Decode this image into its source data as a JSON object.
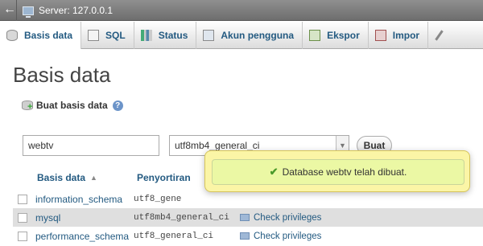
{
  "topbar": {
    "back_icon": "back-arrow-icon",
    "server_label": "Server: 127.0.0.1"
  },
  "tabs": [
    {
      "label": "Basis data",
      "icon": "database-icon",
      "active": true
    },
    {
      "label": "SQL",
      "icon": "sql-icon"
    },
    {
      "label": "Status",
      "icon": "status-icon"
    },
    {
      "label": "Akun pengguna",
      "icon": "user-accounts-icon"
    },
    {
      "label": "Ekspor",
      "icon": "export-icon"
    },
    {
      "label": "Impor",
      "icon": "import-icon"
    }
  ],
  "page": {
    "title": "Basis data",
    "create_label": "Buat basis data",
    "db_name_value": "webtv",
    "collation_value": "utf8mb4_general_ci",
    "create_button": "Buat"
  },
  "table": {
    "headers": {
      "database": "Basis data",
      "collation": "Penyortiran",
      "sort_icon": "sort-asc-icon"
    },
    "rows": [
      {
        "name": "information_schema",
        "collation": "utf8_gene",
        "privileges": ""
      },
      {
        "name": "mysql",
        "collation": "utf8mb4_general_ci",
        "privileges": "Check privileges"
      },
      {
        "name": "performance_schema",
        "collation": "utf8_general_ci",
        "privileges": "Check privileges"
      }
    ]
  },
  "notification": {
    "message": "Database webtv telah dibuat.",
    "icon": "success-check-icon"
  },
  "colors": {
    "link": "#235a81",
    "toast_bg": "#ebf8a4",
    "topbar": "#7d7d7d"
  }
}
